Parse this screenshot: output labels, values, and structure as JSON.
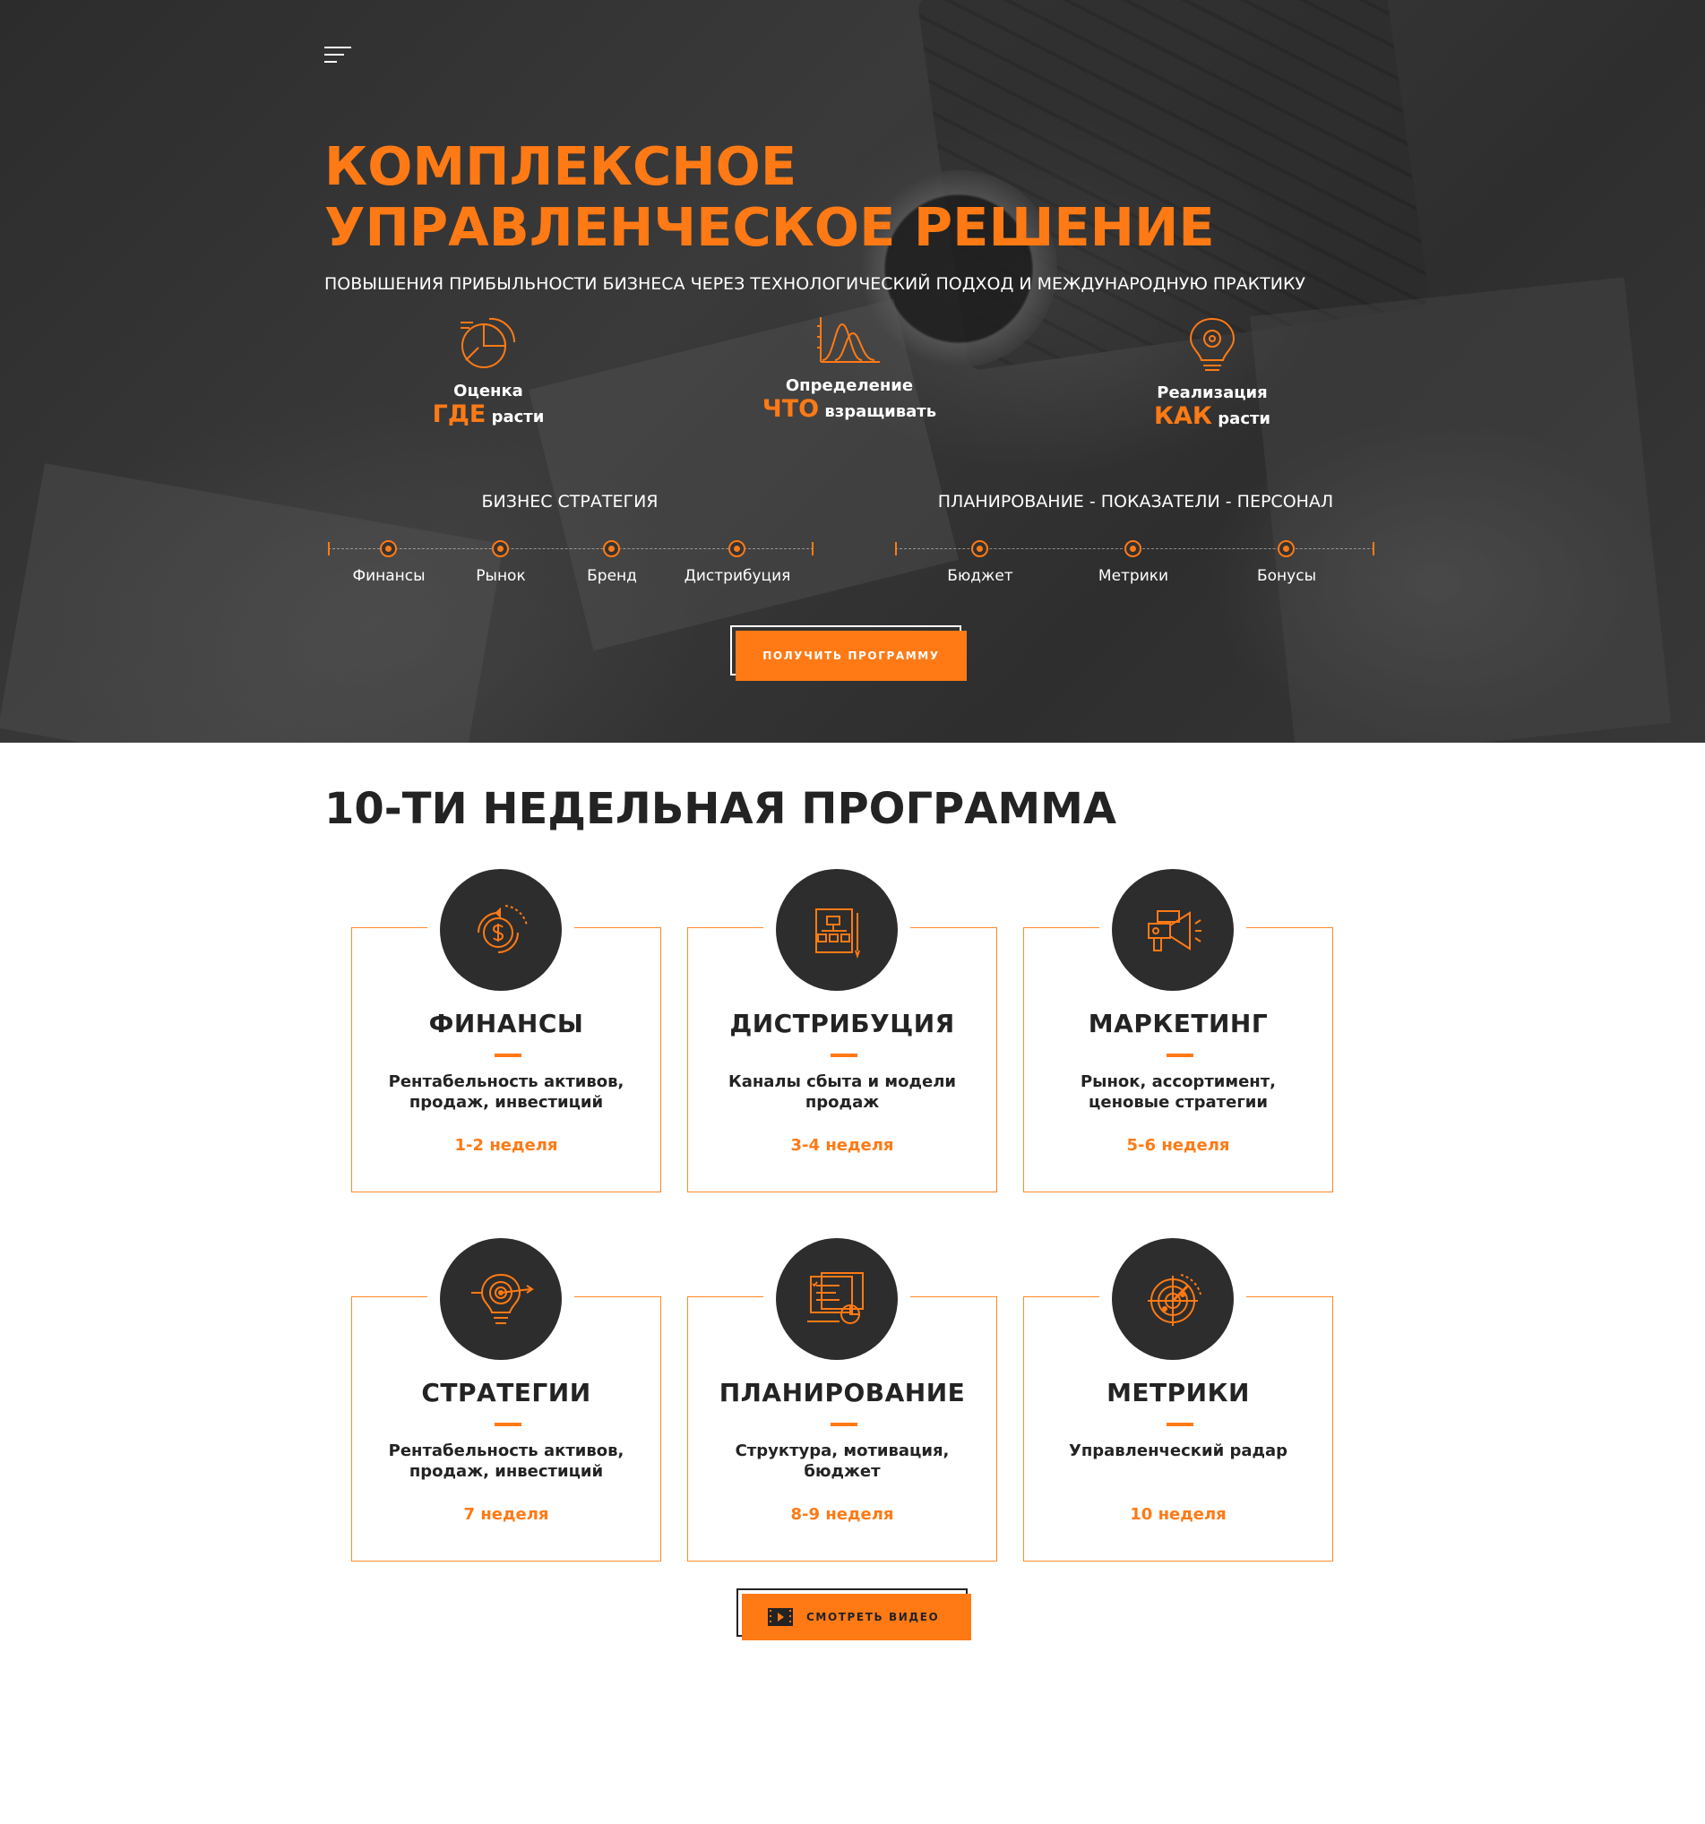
{
  "hero": {
    "title": "КОМПЛЕКСНОЕ УПРАВЛЕНЧЕСКОЕ РЕШЕНИЕ",
    "subtitle": "ПОВЫШЕНИЯ ПРИБЫЛЬНОСТИ БИЗНЕСА ЧЕРЕЗ ТЕХНОЛОГИЧЕСКИЙ ПОДХОД И МЕЖДУНАРОДНУЮ ПРАКТИКУ",
    "features": [
      {
        "line1": "Оценка",
        "accent": "ГДЕ",
        "rest": "расти",
        "icon": "pie-chart-icon"
      },
      {
        "line1": "Определение",
        "accent": "ЧТО",
        "rest": "взращивать",
        "icon": "bell-curve-chart-icon"
      },
      {
        "line1": "Реализация",
        "accent": "КАК",
        "rest": "расти",
        "icon": "lightbulb-gear-icon"
      }
    ],
    "track_left": {
      "title": "БИЗНЕС СТРАТЕГИЯ",
      "steps": [
        "Финансы",
        "Рынок",
        "Бренд",
        "Дистрибуция"
      ]
    },
    "track_right": {
      "title": "ПЛАНИРОВАНИЕ - ПОКАЗАТЕЛИ - ПЕРСОНАЛ",
      "steps": [
        "Бюджет",
        "Метрики",
        "Бонусы"
      ]
    },
    "cta_label": "ПОЛУЧИТЬ ПРОГРАММУ"
  },
  "program": {
    "title": "10-ТИ НЕДЕЛЬНАЯ ПРОГРАММА",
    "cards": [
      {
        "title": "ФИНАНСЫ",
        "desc": "Рентабельность активов, продаж, инвестиций",
        "weeks": "1-2 неделя",
        "icon": "dollar-coin-icon"
      },
      {
        "title": "ДИСТРИБУЦИЯ",
        "desc": "Каналы сбыта и модели продаж",
        "weeks": "3-4 неделя",
        "icon": "org-chart-clipboard-icon"
      },
      {
        "title": "МАРКЕТИНГ",
        "desc": "Рынок, ассортимент, ценовые стратегии",
        "weeks": "5-6 неделя",
        "icon": "megaphone-icon"
      },
      {
        "title": "СТРАТЕГИИ",
        "desc": "Рентабельность активов, продаж, инвестиций",
        "weeks": "7 неделя",
        "icon": "target-arrow-bulb-icon"
      },
      {
        "title": "ПЛАНИРОВАНИЕ",
        "desc": "Структура, мотивация, бюджет",
        "weeks": "8-9 неделя",
        "icon": "planning-board-icon"
      },
      {
        "title": "МЕТРИКИ",
        "desc": "Управленческий радар",
        "weeks": "10 неделя",
        "icon": "radar-icon"
      }
    ],
    "video_label": "СМОТРЕТЬ ВИДЕО"
  },
  "colors": {
    "accent": "#ff7a15",
    "dark": "#2d2d2d",
    "text": "#232323"
  }
}
